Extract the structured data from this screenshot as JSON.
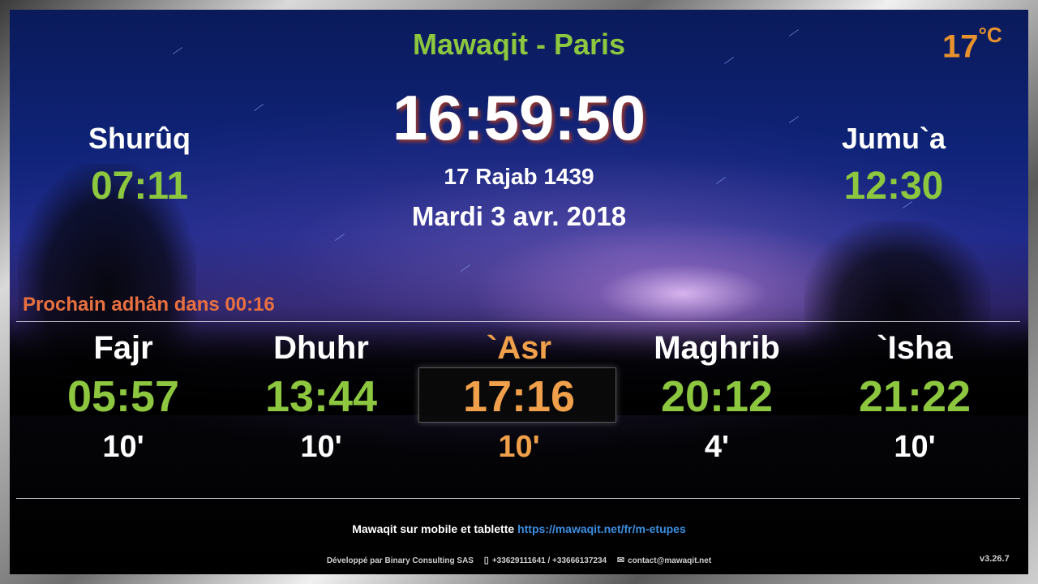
{
  "header": {
    "title": "Mawaqit - Paris",
    "temperature": "17",
    "temperature_unit": "°C"
  },
  "clock": {
    "time": "16:59:50",
    "hijri_date": "17 Rajab 1439",
    "gregorian_date": "Mardi 3 avr. 2018"
  },
  "shuruq": {
    "label": "Shurûq",
    "time": "07:11"
  },
  "jumua": {
    "label": "Jumu`a",
    "time": "12:30"
  },
  "next_adhan": "Prochain adhân dans 00:16",
  "prayers": [
    {
      "name": "Fajr",
      "time": "05:57",
      "iqama": "10'"
    },
    {
      "name": "Dhuhr",
      "time": "13:44",
      "iqama": "10'"
    },
    {
      "name": "`Asr",
      "time": "17:16",
      "iqama": "10'"
    },
    {
      "name": "Maghrib",
      "time": "20:12",
      "iqama": "4'"
    },
    {
      "name": "`Isha",
      "time": "21:22",
      "iqama": "10'"
    }
  ],
  "active_prayer_index": 2,
  "footer": {
    "mobile_text": "Mawaqit sur mobile et tablette",
    "mobile_link": "https://mawaqit.net/fr/m-etupes",
    "developer": "Développé par Binary Consulting SAS",
    "phone_icon": "phone-icon",
    "phones": "+33629111641 / +33666137234",
    "mail_icon": "mail-icon",
    "email": "contact@mawaqit.net",
    "version": "v3.26.7"
  },
  "colors": {
    "accent_green": "#8dc63f",
    "accent_orange": "#e8922e",
    "next_adhan": "#e87040",
    "link": "#3c8ee0"
  }
}
